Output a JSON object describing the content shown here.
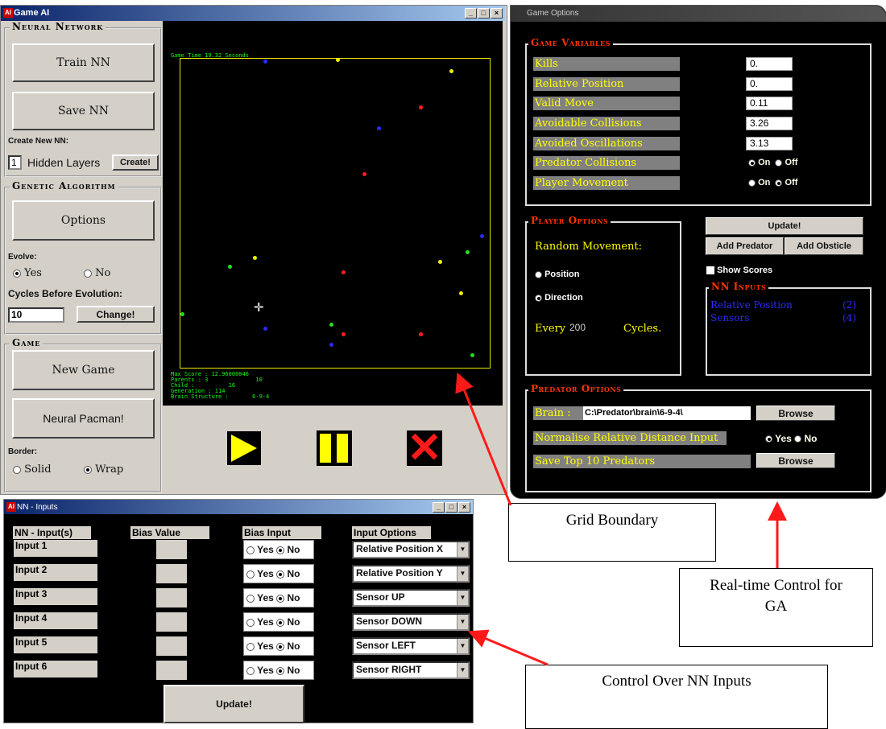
{
  "game_window": {
    "title": "Game AI",
    "title_buttons": [
      "_",
      "□",
      "×"
    ],
    "neural_network": {
      "label": "Neural Network",
      "train_button": "Train NN",
      "save_button": "Save NN",
      "create_label": "Create New NN:",
      "hidden_layers_value": "1",
      "hidden_layers_label": "Hidden Layers",
      "create_button": "Create!"
    },
    "genetic_algorithm": {
      "label": "Genetic Algorithm",
      "options_button": "Options",
      "evolve_label": "Evolve:",
      "evolve_yes": "Yes",
      "evolve_no": "No",
      "evolve_selected": "Yes",
      "cycles_label": "Cycles Before Evolution:",
      "cycles_value": "10",
      "change_button": "Change!"
    },
    "game": {
      "label": "Game",
      "new_game_button": "New Game",
      "pacman_button": "Neural Pacman!",
      "border_label": "Border:",
      "border_solid": "Solid",
      "border_wrap": "Wrap",
      "border_selected": "Wrap"
    },
    "canvas": {
      "game_time": "Game Time 19.32 Seconds",
      "stats": "Max Score : 12.96000046\nParents : 3              10\nChild :          16\nGeneration : 114\nBrain Structure :       6-9-4"
    },
    "controls": {
      "play_icon": "play-icon",
      "pause_icon": "pause-icon",
      "stop_icon": "stop-icon"
    },
    "colors": {
      "grid": "#e8e800",
      "red": "#ff2020",
      "blue": "#2a2aff",
      "green": "#20e020",
      "yellow": "#f0f000"
    }
  },
  "options_window": {
    "title": "Game Options",
    "game_variables": {
      "label": "Game Variables",
      "rows": [
        {
          "label": "Kills",
          "value": "0."
        },
        {
          "label": "Relative Position",
          "value": "0."
        },
        {
          "label": "Valid Move",
          "value": "0.11"
        },
        {
          "label": "Avoidable Collisions",
          "value": "3.26"
        },
        {
          "label": "Avoided Oscillations",
          "value": "3.13"
        }
      ],
      "predator_collisions": {
        "label": "Predator Collisions",
        "on": "On",
        "off": "Off",
        "selected": "On"
      },
      "player_movement": {
        "label": "Player Movement",
        "on": "On",
        "off": "Off",
        "selected": "Off"
      }
    },
    "player_options": {
      "label": "Player Options",
      "random_movement": "Random Movement:",
      "position": "Position",
      "direction": "Direction",
      "every": "Every",
      "every_value": "200",
      "cycles": "Cycles."
    },
    "update_button": "Update!",
    "add_predator_button": "Add Predator",
    "add_obstacle_button": "Add Obsticle",
    "show_scores": "Show Scores",
    "nn_inputs": {
      "label": "NN Inputs",
      "items": [
        {
          "name": "Relative Position",
          "count": "(2)"
        },
        {
          "name": "Sensors",
          "count": "(4)"
        }
      ]
    },
    "predator_options": {
      "label": "Predator Options",
      "brain_label": "Brain :",
      "brain_path": "C:\\Predator\\brain\\6-9-4\\",
      "browse_button": "Browse",
      "normalise_label": "Normalise Relative Distance Input",
      "yes": "Yes",
      "no": "No",
      "normalise_selected": "Yes",
      "save_top_label": "Save Top 10 Predators",
      "browse2_button": "Browse"
    }
  },
  "nn_window": {
    "title": "NN - Inputs",
    "headers": [
      "NN - Input(s)",
      "Bias Value",
      "Bias Input",
      "Input Options"
    ],
    "rows": [
      {
        "input": "Input 1",
        "yes": "Yes",
        "no": "No",
        "option": "Relative Position X"
      },
      {
        "input": "Input 2",
        "yes": "Yes",
        "no": "No",
        "option": "Relative Position Y"
      },
      {
        "input": "Input 3",
        "yes": "Yes",
        "no": "No",
        "option": "Sensor UP"
      },
      {
        "input": "Input 4",
        "yes": "Yes",
        "no": "No",
        "option": "Sensor DOWN"
      },
      {
        "input": "Input 5",
        "yes": "Yes",
        "no": "No",
        "option": "Sensor LEFT"
      },
      {
        "input": "Input 6",
        "yes": "Yes",
        "no": "No",
        "option": "Sensor RIGHT"
      }
    ],
    "update_button": "Update!"
  },
  "callouts": {
    "grid_boundary": "Grid Boundary",
    "realtime_line1": "Real-time Control for",
    "realtime_line2": "GA",
    "control_nn": "Control Over NN Inputs"
  }
}
